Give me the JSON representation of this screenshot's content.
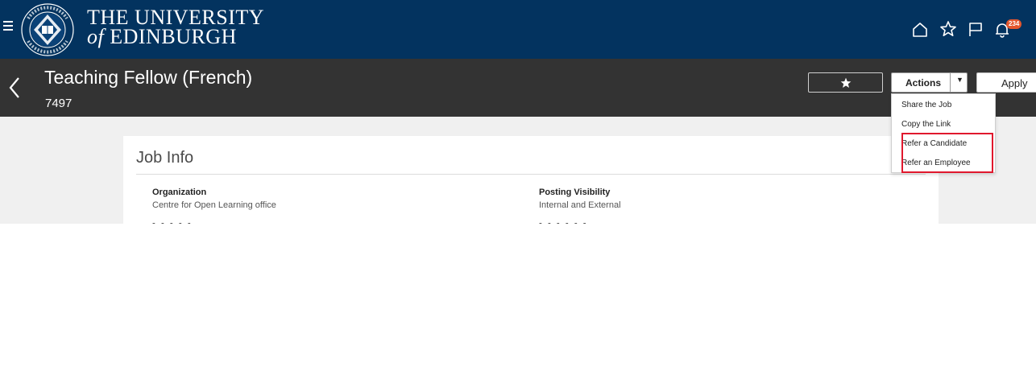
{
  "header": {
    "brand_line1": "THE UNIVERSITY",
    "brand_line2_prefix": "of",
    "brand_line2_main": "EDINBURGH",
    "notification_count": "234",
    "icons": [
      "menu-icon",
      "home-icon",
      "star-icon",
      "flag-icon",
      "bell-icon"
    ]
  },
  "titlebar": {
    "job_title": "Teaching Fellow (French)",
    "job_id": "7497",
    "actions_label": "Actions",
    "apply_label": "Apply"
  },
  "actions_menu": {
    "items": [
      {
        "label": "Share the Job"
      },
      {
        "label": "Copy the Link"
      },
      {
        "label": "Refer a Candidate"
      },
      {
        "label": "Refer an Employee"
      }
    ]
  },
  "job_info": {
    "title": "Job Info",
    "fields": [
      {
        "label": "Organization",
        "value": "Centre for Open Learning office"
      },
      {
        "label": "Posting Visibility",
        "value": "Internal and External"
      }
    ]
  },
  "colors": {
    "banner": "#03335f",
    "titlebar": "#333333",
    "highlight": "#e0182d",
    "badge": "#e4572e"
  }
}
